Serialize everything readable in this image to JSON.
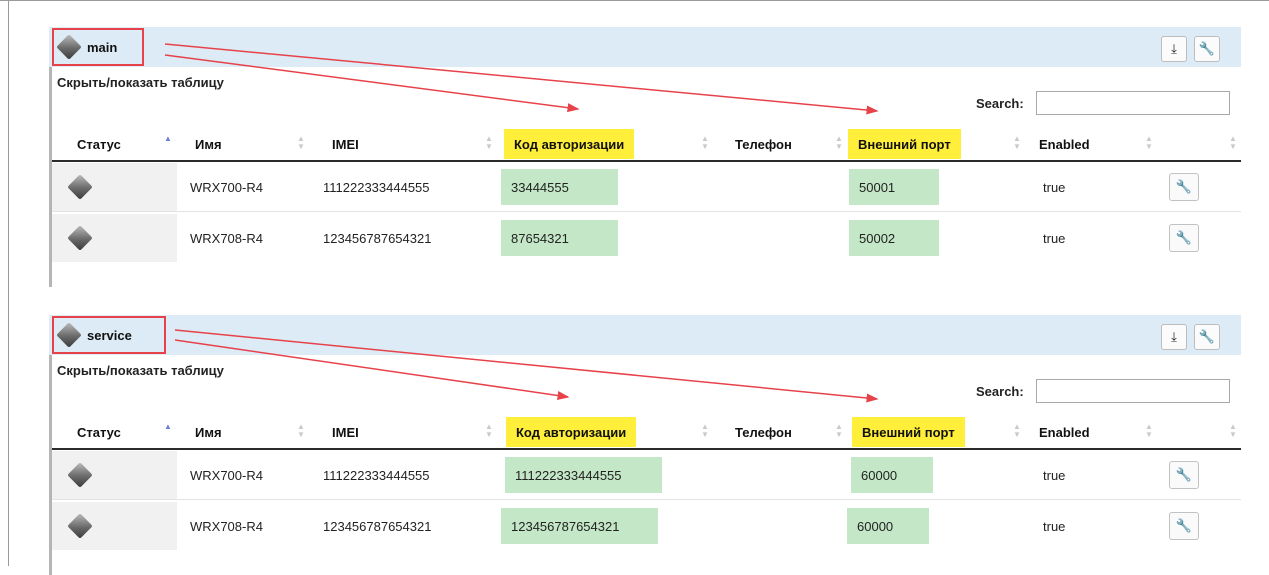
{
  "groups": [
    {
      "title": "main",
      "toggle_label": "Скрыть/показать таблицу",
      "search_label": "Search:",
      "search_value": "",
      "columns": [
        "Статус",
        "Имя",
        "IMEI",
        "Код авторизации",
        "Телефон",
        "Внешний порт",
        "Enabled"
      ],
      "rows": [
        {
          "name": "WRX700-R4",
          "imei": "111222333444555",
          "auth_code": "33444555",
          "phone": "",
          "external_port": "50001",
          "enabled": "true"
        },
        {
          "name": "WRX708-R4",
          "imei": "123456787654321",
          "auth_code": "87654321",
          "phone": "",
          "external_port": "50002",
          "enabled": "true"
        }
      ]
    },
    {
      "title": "service",
      "toggle_label": "Скрыть/показать таблицу",
      "search_label": "Search:",
      "search_value": "",
      "columns": [
        "Статус",
        "Имя",
        "IMEI",
        "Код авторизации",
        "Телефон",
        "Внешний порт",
        "Enabled"
      ],
      "rows": [
        {
          "name": "WRX700-R4",
          "imei": "111222333444555",
          "auth_code": "111222333444555",
          "phone": "",
          "external_port": "60000",
          "enabled": "true"
        },
        {
          "name": "WRX708-R4",
          "imei": "123456787654321",
          "auth_code": "123456787654321",
          "phone": "",
          "external_port": "60000",
          "enabled": "true"
        }
      ]
    }
  ],
  "icons": {
    "status": "gray-diamond-icon",
    "download": "download-icon",
    "settings": "wrench-icon",
    "sort": "sort-arrows-icon"
  },
  "colors": {
    "header_band": "#dcebf6",
    "highlight_yellow": "#ffef3a",
    "highlight_green": "#c4e8c7",
    "annotation_red": "#e7424a",
    "sort_active": "#6b7fd8"
  }
}
